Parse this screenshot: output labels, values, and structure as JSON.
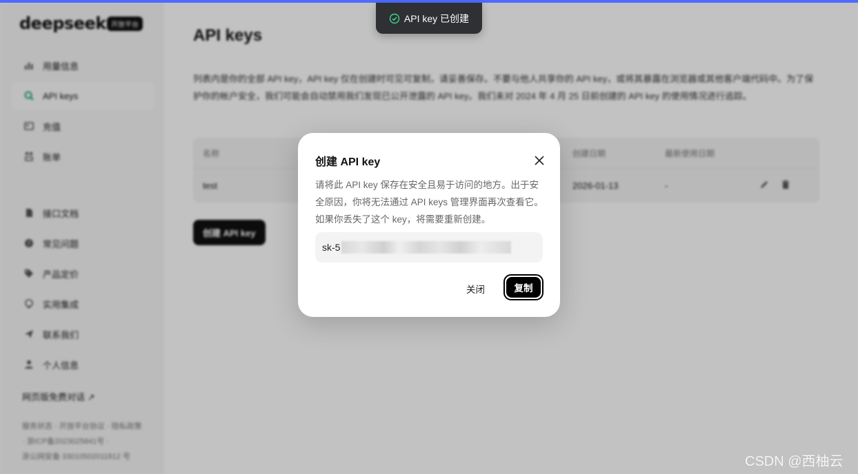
{
  "colors": {
    "accent_bar": "#4D6BFE",
    "toast_bg": "#2F3033",
    "toast_icon": "#3DD68C",
    "primary_button": "#000000"
  },
  "toast": {
    "icon": "check-circle-icon",
    "text": "API key 已创建"
  },
  "sidebar": {
    "logo": "deepseek",
    "badge": "开放平台",
    "items": [
      {
        "label": "用量信息",
        "icon": "bar-chart-icon"
      },
      {
        "label": "API keys",
        "icon": "search-key-icon",
        "active": true
      },
      {
        "label": "充值",
        "icon": "wallet-icon"
      },
      {
        "label": "账单",
        "icon": "bill-icon"
      },
      {
        "label": "接口文档",
        "icon": "document-icon"
      },
      {
        "label": "常见问题",
        "icon": "question-icon"
      },
      {
        "label": "产品定价",
        "icon": "price-tag-icon"
      },
      {
        "label": "实用集成",
        "icon": "integration-icon"
      },
      {
        "label": "联系我们",
        "icon": "send-icon"
      },
      {
        "label": "个人信息",
        "icon": "user-icon"
      }
    ],
    "web_chat_link": "网页版免费对话 ↗",
    "footer_line1": "服务状态 · 开放平台协议 · 隐私政策",
    "footer_line2": "· 浙ICP备2023025841号 ·",
    "footer_line3": "浙公网安备 33010502011812 号"
  },
  "main": {
    "title": "API keys",
    "description": "列表内是你的全部 API key，API key 仅在创建时可见可复制，请妥善保存。不要与他人共享你的 API key，或将其暴露在浏览器或其他客户端代码中。为了保护你的帐户安全，我们可能会自动禁用我们发现已公开泄露的 API key。我们未对 2024 年 4 月 25 日前创建的 API key 的使用情况进行追踪。",
    "table": {
      "headers": [
        "名称",
        "创建日期",
        "最新使用日期"
      ],
      "rows": [
        {
          "name": "test",
          "created": "2026-01-13",
          "last_used": "-"
        }
      ]
    },
    "create_button": "创建 API key"
  },
  "modal": {
    "title": "创建 API key",
    "description": "请将此 API key 保存在安全且易于访问的地方。出于安全原因，你将无法通过 API keys 管理界面再次查看它。如果你丢失了这个 key，将需要重新创建。",
    "key_prefix": "sk-5",
    "close_label": "关闭",
    "copy_label": "复制"
  },
  "watermark": "CSDN @西柚云"
}
